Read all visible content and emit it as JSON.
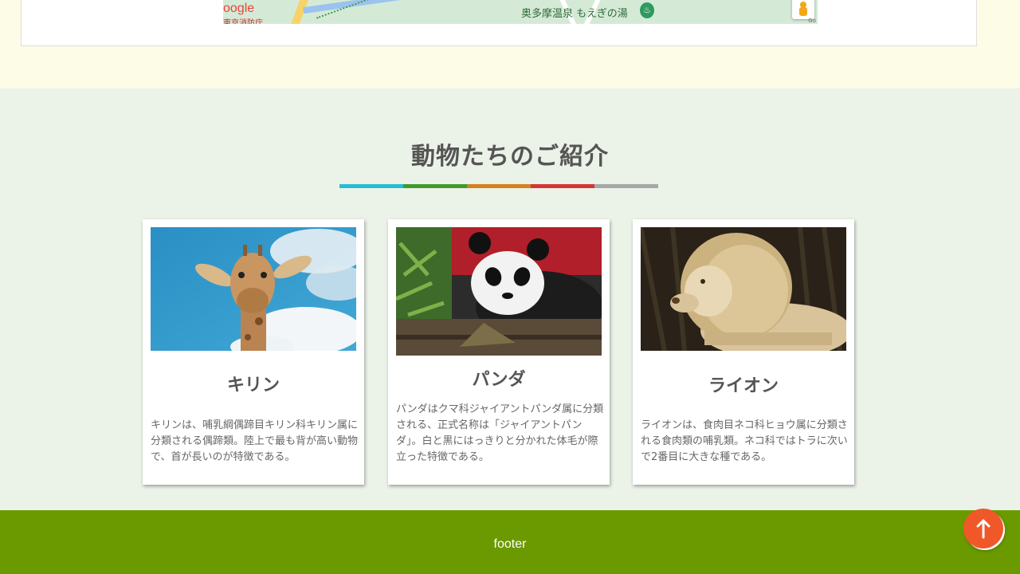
{
  "map": {
    "brand": "oogle",
    "road_label": "東京消防庁",
    "place": "奥多摩温泉 もえぎの湯",
    "onsen_symbol": "♨",
    "credit": "Go"
  },
  "animals_section": {
    "title": "動物たちのご紹介",
    "bar_colors": [
      "#28bcd3",
      "#3f9b2c",
      "#d3821f",
      "#d23636",
      "#a8a8a8"
    ],
    "cards": [
      {
        "name": "キリン",
        "description": "キリンは、哺乳綱偶蹄目キリン科キリン属に分類される偶蹄類。陸上で最も背が高い動物で、首が長いのが特徴である。"
      },
      {
        "name": "パンダ",
        "description": "パンダはクマ科ジャイアントパンダ属に分類される、正式名称は「ジャイアントパンダ」。白と黒にはっきりと分かれた体毛が際立った特徴である。"
      },
      {
        "name": "ライオン",
        "description": "ライオンは、食肉目ネコ科ヒョウ属に分類される食肉類の哺乳類。ネコ科ではトラに次いで2番目に大きな種である。"
      }
    ]
  },
  "footer": {
    "text": "footer"
  },
  "back_to_top": {
    "icon": "arrow-up-icon",
    "color": "#f0582a"
  }
}
